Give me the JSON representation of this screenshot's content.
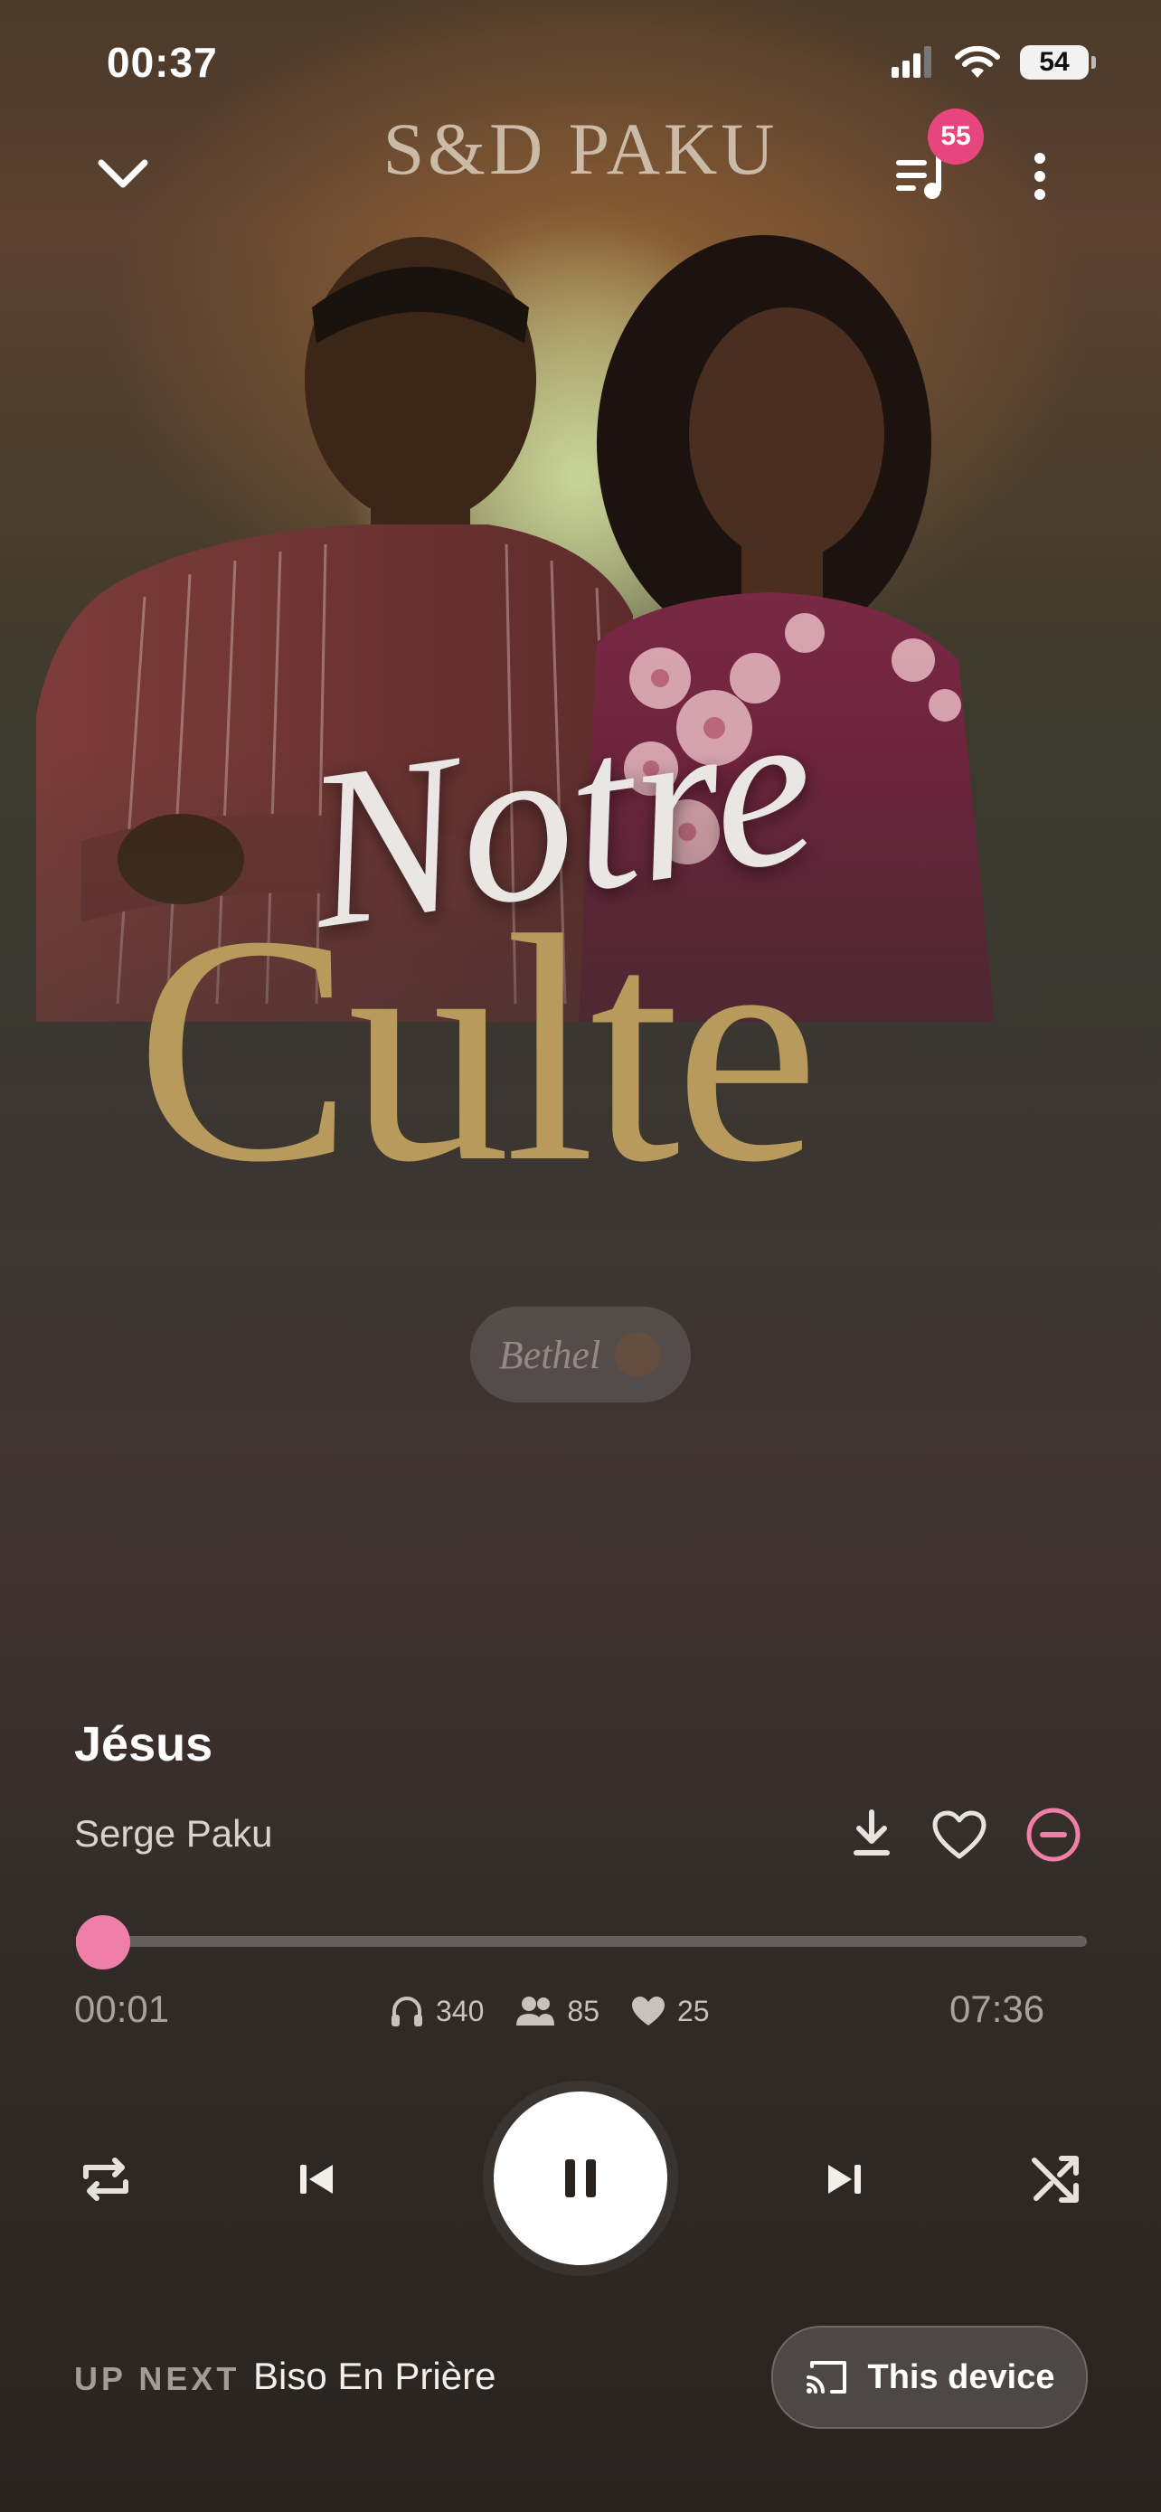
{
  "status_bar": {
    "time": "00:37",
    "battery": "54"
  },
  "top_bar": {
    "brand": "S&D PAKU",
    "queue_badge": "55"
  },
  "artwork": {
    "title_script": "Notre",
    "title_serif": "Culte",
    "label_logo": "Bethel"
  },
  "track": {
    "title": "Jésus",
    "artist": "Serge Paku"
  },
  "progress": {
    "elapsed": "00:01",
    "duration": "07:36",
    "fraction": 0.002
  },
  "stats": {
    "listens": "340",
    "listeners": "85",
    "likes": "25"
  },
  "controls": {
    "state": "playing"
  },
  "up_next": {
    "label": "UP NEXT",
    "title": "Biso En Prière"
  },
  "device": {
    "label": "This device"
  },
  "colors": {
    "accent": "#ef7fa8",
    "badge": "#e8457e"
  },
  "icons": [
    "chevron-down-icon",
    "queue-icon",
    "more-vert-icon",
    "download-icon",
    "heart-icon",
    "remove-circle-icon",
    "headphones-icon",
    "people-icon",
    "repeat-icon",
    "skip-previous-icon",
    "pause-icon",
    "skip-next-icon",
    "shuffle-icon",
    "cast-icon"
  ]
}
